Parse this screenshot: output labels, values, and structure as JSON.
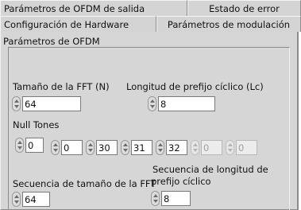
{
  "tabs": {
    "row1": [
      "Parámetros de OFDM de salida",
      "Estado de error"
    ],
    "row2": [
      "Configuración de Hardware",
      "Parámetros de modulación"
    ]
  },
  "panel": {
    "title": "Parámetros de OFDM",
    "fft_size_label": "Tamaño de la FFT (N)",
    "fft_size_value": "64",
    "cp_length_label": "Longitud de prefijo cíclico (Lc)",
    "cp_length_value": "8",
    "null_tones_label": "Null Tones",
    "null_tones_index": "0",
    "null_tones_values": [
      "0",
      "30",
      "31",
      "32",
      "0",
      "0"
    ],
    "fft_seq_label": "Secuencia de tamaño de la FFT",
    "fft_seq_value": "64",
    "cp_seq_label_line1": "Secuencia de longitud de",
    "cp_seq_label_line2": "prefijo cíclico",
    "cp_seq_value": "8"
  }
}
